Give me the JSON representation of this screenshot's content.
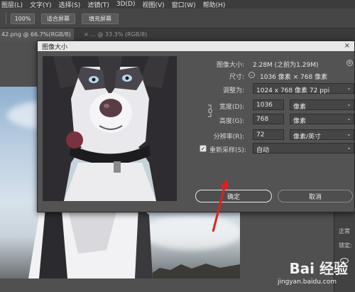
{
  "menubar": {
    "items": [
      "图层(L)",
      "文字(Y)",
      "选择(S)",
      "滤镜(T)",
      "3D(D)",
      "视图(V)",
      "窗口(W)",
      "帮助(H)"
    ]
  },
  "options_bar": {
    "zoom_button": "100%",
    "fit_screen_button": "适合屏幕",
    "fill_screen_button": "填充屏幕"
  },
  "tabs": {
    "active": "42.png @ 66.7%(RGB/8)",
    "active_close": "×",
    "inactive": "× ... @ 33.3% (RGB/8)"
  },
  "right_panel": {
    "label1": "正常",
    "label2": "锁定:"
  },
  "dialog": {
    "title": "图像大小",
    "close": "×",
    "image_size_label": "图像大小:",
    "image_size_value": "2.28M (之前为1.29M)",
    "dimensions_label": "尺寸:",
    "dimensions_value": "1036 像素 × 768 像素",
    "fit_to_label": "调整为:",
    "fit_to_value": "1024 x 768 像素 72 ppi",
    "width_label": "宽度(D):",
    "width_value": "1036",
    "width_unit": "像素",
    "height_label": "高度(G):",
    "height_value": "768",
    "height_unit": "像素",
    "resolution_label": "分辨率(R):",
    "resolution_value": "72",
    "resolution_unit": "像素/英寸",
    "resample_label": "重新采样(S):",
    "resample_value": "自动",
    "resample_checked": "✓",
    "ok_button": "确定",
    "cancel_button": "取消"
  },
  "watermark": {
    "logo": "Bai 经验",
    "url": "jingyan.baidu.com"
  },
  "colors": {
    "annotation_arrow": "#e02020",
    "dialog_bg": "#535353",
    "title_bar": "#e8e8e8"
  }
}
